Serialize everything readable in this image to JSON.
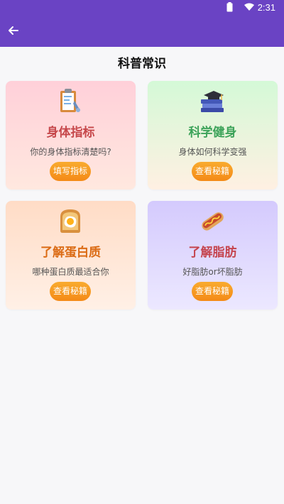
{
  "status": {
    "time": "2:31"
  },
  "header": {
    "title": "科普常识"
  },
  "cards": [
    {
      "title": "身体指标",
      "subtitle": "你的身体指标清楚吗?",
      "button": "填写指标",
      "icon": "clipboard-icon"
    },
    {
      "title": "科学健身",
      "subtitle": "身体如何科学变强",
      "button": "查看秘籍",
      "icon": "books-icon"
    },
    {
      "title": "了解蛋白质",
      "subtitle": "哪种蛋白质最适合你",
      "button": "查看秘籍",
      "icon": "fried-egg-toast-icon"
    },
    {
      "title": "了解脂肪",
      "subtitle": "好脂肪or坏脂肪",
      "button": "查看秘籍",
      "icon": "hotdog-icon"
    }
  ],
  "colors": {
    "topbar": "#6a43c4",
    "button": "#f48a17",
    "card1_title": "#c6484b",
    "card2_title": "#3da35a",
    "card3_title": "#db6b14",
    "card4_title": "#c5444e"
  }
}
